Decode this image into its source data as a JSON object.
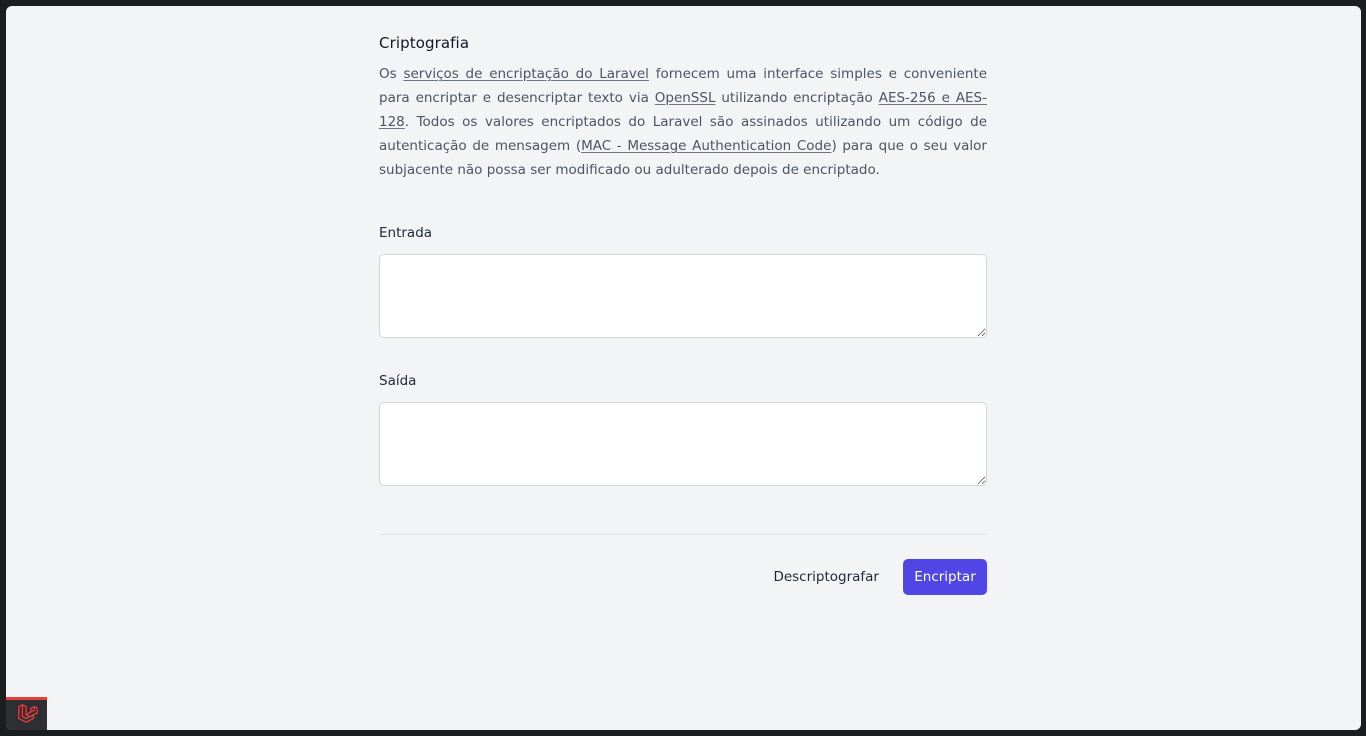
{
  "page": {
    "title": "Criptografia",
    "description": {
      "p1": "Os ",
      "link1": "serviços de encriptação do Laravel",
      "p2": " fornecem uma interface simples e conveniente para encriptar e desencriptar texto via ",
      "link2": "OpenSSL",
      "p3": " utilizando encriptação ",
      "link3": "AES-256 e AES-128",
      "p4": ". Todos os valores encriptados do Laravel são assinados utilizando um código de autenticação de mensagem (",
      "link4": "MAC - Message Authentication Code",
      "p5": ") para que o seu valor subjacente não possa ser modificado ou adulterado depois de encriptado."
    }
  },
  "form": {
    "input_label": "Entrada",
    "input_value": "",
    "output_label": "Saída",
    "output_value": "",
    "decrypt_button": "Descriptografar",
    "encrypt_button": "Encriptar"
  },
  "colors": {
    "primary": "#4f46e5",
    "background": "#f3f4f6",
    "laravel_red": "#e53e3e"
  },
  "icons": {
    "debugbar": "laravel-logo-icon"
  }
}
